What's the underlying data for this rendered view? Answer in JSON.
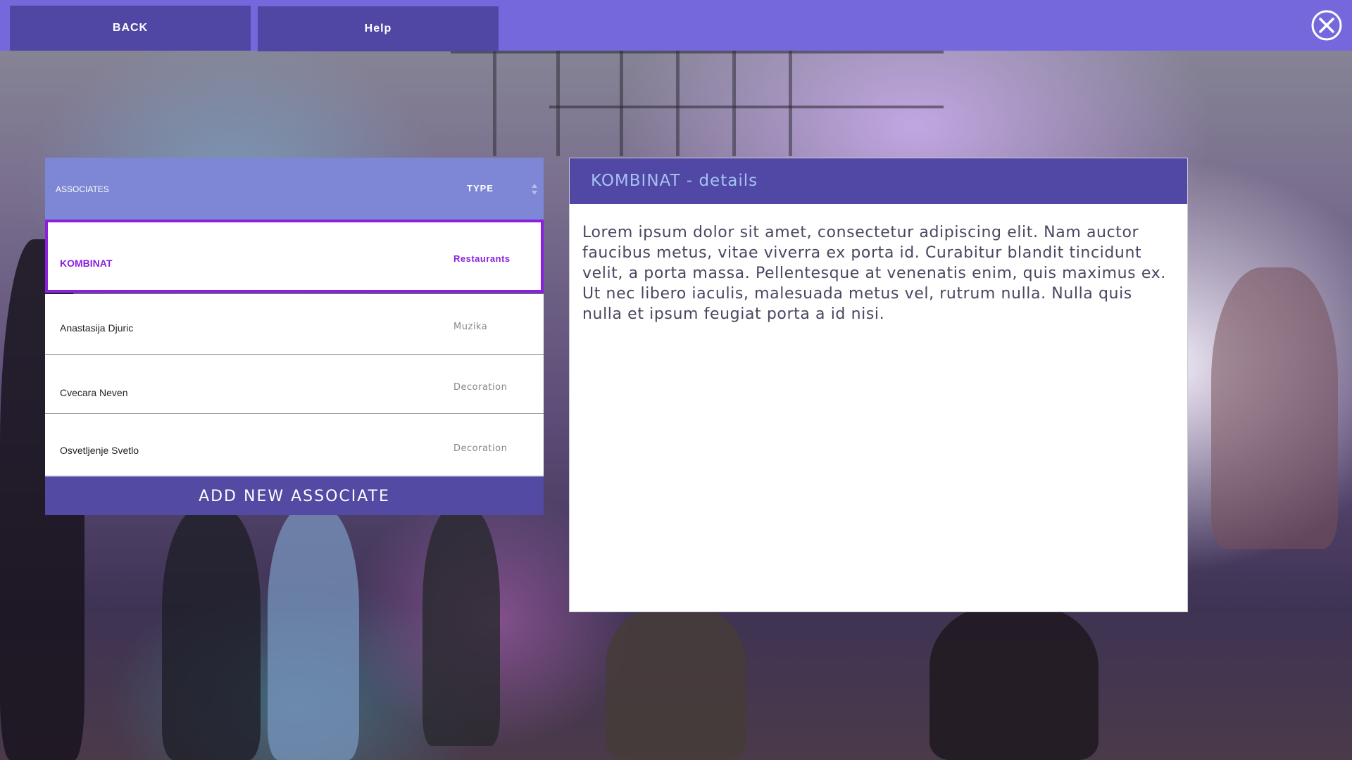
{
  "topbar": {
    "back_label": "BACK",
    "help_label": "Help"
  },
  "associates": {
    "header": {
      "name_col": "ASSOCIATES",
      "type_col": "TYPE"
    },
    "rows": [
      {
        "name": "KOMBINAT",
        "type": "Restaurants"
      },
      {
        "name": "Anastasija Djuric",
        "type": "Muzika"
      },
      {
        "name": "Cvecara Neven",
        "type": "Decoration"
      },
      {
        "name": "Osvetljenje Svetlo",
        "type": "Decoration"
      }
    ],
    "selected_index": 0,
    "add_label": "ADD NEW ASSOCIATE"
  },
  "details": {
    "title": "KOMBINAT - details",
    "body": "Lorem ipsum dolor sit amet, consectetur adipiscing elit. Nam auctor faucibus metus, vitae viverra ex porta id. Curabitur blandit tincidunt velit, a porta massa. Pellentesque at venenatis enim, quis maximus ex. Ut nec libero iaculis, malesuada metus vel, rutrum nulla. Nulla quis nulla et ipsum feugiat porta a id nisi."
  },
  "colors": {
    "topbar": "#7468dc",
    "button": "#4f47a3",
    "accent": "#8a1fe0",
    "table_header": "#7e86d6",
    "details_title": "#a7c1f2"
  },
  "icons": {
    "close": "close-circle-icon",
    "sort": "sort-icon"
  }
}
